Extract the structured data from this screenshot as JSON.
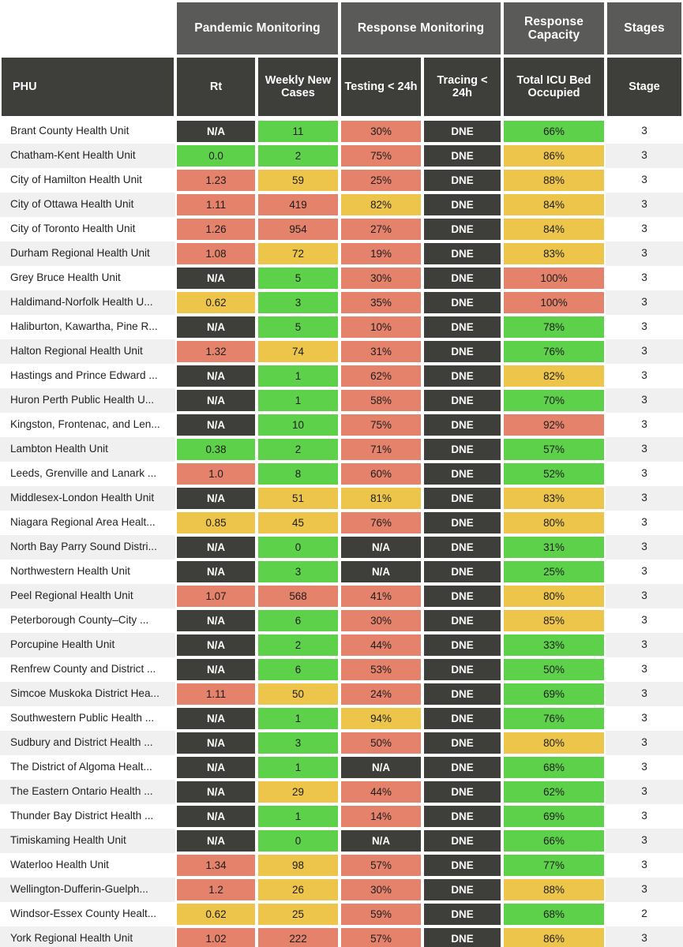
{
  "table": {
    "group_headers": [
      {
        "label": "",
        "span": 1,
        "visible": false
      },
      {
        "label": "Pandemic Monitoring",
        "span": 2,
        "visible": true
      },
      {
        "label": "Response Monitoring",
        "span": 2,
        "visible": true
      },
      {
        "label": "Response Capacity",
        "span": 1,
        "visible": true
      },
      {
        "label": "Stages",
        "span": 1,
        "visible": true
      }
    ],
    "columns": [
      {
        "key": "phu",
        "label": "PHU"
      },
      {
        "key": "rt",
        "label": "Rt"
      },
      {
        "key": "cases",
        "label": "Weekly New Cases"
      },
      {
        "key": "test",
        "label": "Testing < 24h"
      },
      {
        "key": "trace",
        "label": "Tracing < 24h"
      },
      {
        "key": "icu",
        "label": "Total ICU Bed Occupied"
      },
      {
        "key": "stage",
        "label": "Stage"
      }
    ],
    "colors": {
      "green": "#5ed14a",
      "yellow": "#edc54b",
      "red": "#e4826b",
      "dark": "#3e3e3b",
      "group_header": "#5a5a58",
      "sub_header": "#3e3e3b",
      "row_stripe": "#f0f0f0",
      "row_base": "#ffffff"
    },
    "rows": [
      {
        "phu": "Brant County Health Unit",
        "rt": "N/A",
        "rt_c": "dark",
        "cases": "11",
        "cases_c": "green",
        "test": "30%",
        "test_c": "red",
        "trace": "DNE",
        "trace_c": "dark",
        "icu": "66%",
        "icu_c": "green",
        "stage": "3"
      },
      {
        "phu": "Chatham-Kent Health Unit",
        "rt": "0.0",
        "rt_c": "green",
        "cases": "2",
        "cases_c": "green",
        "test": "75%",
        "test_c": "red",
        "trace": "DNE",
        "trace_c": "dark",
        "icu": "86%",
        "icu_c": "yellow",
        "stage": "3"
      },
      {
        "phu": "City of Hamilton Health Unit",
        "rt": "1.23",
        "rt_c": "red",
        "cases": "59",
        "cases_c": "yellow",
        "test": "25%",
        "test_c": "red",
        "trace": "DNE",
        "trace_c": "dark",
        "icu": "88%",
        "icu_c": "yellow",
        "stage": "3"
      },
      {
        "phu": "City of Ottawa Health Unit",
        "rt": "1.11",
        "rt_c": "red",
        "cases": "419",
        "cases_c": "red",
        "test": "82%",
        "test_c": "yellow",
        "trace": "DNE",
        "trace_c": "dark",
        "icu": "84%",
        "icu_c": "yellow",
        "stage": "3"
      },
      {
        "phu": "City of Toronto Health Unit",
        "rt": "1.26",
        "rt_c": "red",
        "cases": "954",
        "cases_c": "red",
        "test": "27%",
        "test_c": "red",
        "trace": "DNE",
        "trace_c": "dark",
        "icu": "84%",
        "icu_c": "yellow",
        "stage": "3"
      },
      {
        "phu": "Durham Regional Health Unit",
        "rt": "1.08",
        "rt_c": "red",
        "cases": "72",
        "cases_c": "yellow",
        "test": "19%",
        "test_c": "red",
        "trace": "DNE",
        "trace_c": "dark",
        "icu": "83%",
        "icu_c": "yellow",
        "stage": "3"
      },
      {
        "phu": "Grey Bruce Health Unit",
        "rt": "N/A",
        "rt_c": "dark",
        "cases": "5",
        "cases_c": "green",
        "test": "30%",
        "test_c": "red",
        "trace": "DNE",
        "trace_c": "dark",
        "icu": "100%",
        "icu_c": "red",
        "stage": "3"
      },
      {
        "phu": "Haldimand-Norfolk Health U...",
        "rt": "0.62",
        "rt_c": "yellow",
        "cases": "3",
        "cases_c": "green",
        "test": "35%",
        "test_c": "red",
        "trace": "DNE",
        "trace_c": "dark",
        "icu": "100%",
        "icu_c": "red",
        "stage": "3"
      },
      {
        "phu": "Haliburton, Kawartha, Pine R...",
        "rt": "N/A",
        "rt_c": "dark",
        "cases": "5",
        "cases_c": "green",
        "test": "10%",
        "test_c": "red",
        "trace": "DNE",
        "trace_c": "dark",
        "icu": "78%",
        "icu_c": "green",
        "stage": "3"
      },
      {
        "phu": "Halton Regional Health Unit",
        "rt": "1.32",
        "rt_c": "red",
        "cases": "74",
        "cases_c": "yellow",
        "test": "31%",
        "test_c": "red",
        "trace": "DNE",
        "trace_c": "dark",
        "icu": "76%",
        "icu_c": "green",
        "stage": "3"
      },
      {
        "phu": "Hastings and Prince Edward ...",
        "rt": "N/A",
        "rt_c": "dark",
        "cases": "1",
        "cases_c": "green",
        "test": "62%",
        "test_c": "red",
        "trace": "DNE",
        "trace_c": "dark",
        "icu": "82%",
        "icu_c": "yellow",
        "stage": "3"
      },
      {
        "phu": "Huron Perth Public Health U...",
        "rt": "N/A",
        "rt_c": "dark",
        "cases": "1",
        "cases_c": "green",
        "test": "58%",
        "test_c": "red",
        "trace": "DNE",
        "trace_c": "dark",
        "icu": "70%",
        "icu_c": "green",
        "stage": "3"
      },
      {
        "phu": "Kingston, Frontenac, and Len...",
        "rt": "N/A",
        "rt_c": "dark",
        "cases": "10",
        "cases_c": "green",
        "test": "75%",
        "test_c": "red",
        "trace": "DNE",
        "trace_c": "dark",
        "icu": "92%",
        "icu_c": "red",
        "stage": "3"
      },
      {
        "phu": "Lambton Health Unit",
        "rt": "0.38",
        "rt_c": "green",
        "cases": "2",
        "cases_c": "green",
        "test": "71%",
        "test_c": "red",
        "trace": "DNE",
        "trace_c": "dark",
        "icu": "57%",
        "icu_c": "green",
        "stage": "3"
      },
      {
        "phu": "Leeds, Grenville and Lanark ...",
        "rt": "1.0",
        "rt_c": "red",
        "cases": "8",
        "cases_c": "green",
        "test": "60%",
        "test_c": "red",
        "trace": "DNE",
        "trace_c": "dark",
        "icu": "52%",
        "icu_c": "green",
        "stage": "3"
      },
      {
        "phu": "Middlesex-London Health Unit",
        "rt": "N/A",
        "rt_c": "dark",
        "cases": "51",
        "cases_c": "yellow",
        "test": "81%",
        "test_c": "yellow",
        "trace": "DNE",
        "trace_c": "dark",
        "icu": "83%",
        "icu_c": "yellow",
        "stage": "3"
      },
      {
        "phu": "Niagara Regional Area Healt...",
        "rt": "0.85",
        "rt_c": "yellow",
        "cases": "45",
        "cases_c": "yellow",
        "test": "76%",
        "test_c": "red",
        "trace": "DNE",
        "trace_c": "dark",
        "icu": "80%",
        "icu_c": "yellow",
        "stage": "3"
      },
      {
        "phu": "North Bay Parry Sound Distri...",
        "rt": "N/A",
        "rt_c": "dark",
        "cases": "0",
        "cases_c": "green",
        "test": "N/A",
        "test_c": "dark",
        "trace": "DNE",
        "trace_c": "dark",
        "icu": "31%",
        "icu_c": "green",
        "stage": "3"
      },
      {
        "phu": "Northwestern Health Unit",
        "rt": "N/A",
        "rt_c": "dark",
        "cases": "3",
        "cases_c": "green",
        "test": "N/A",
        "test_c": "dark",
        "trace": "DNE",
        "trace_c": "dark",
        "icu": "25%",
        "icu_c": "green",
        "stage": "3"
      },
      {
        "phu": "Peel Regional Health Unit",
        "rt": "1.07",
        "rt_c": "red",
        "cases": "568",
        "cases_c": "red",
        "test": "41%",
        "test_c": "red",
        "trace": "DNE",
        "trace_c": "dark",
        "icu": "80%",
        "icu_c": "yellow",
        "stage": "3"
      },
      {
        "phu": "Peterborough County–City ...",
        "rt": "N/A",
        "rt_c": "dark",
        "cases": "6",
        "cases_c": "green",
        "test": "30%",
        "test_c": "red",
        "trace": "DNE",
        "trace_c": "dark",
        "icu": "85%",
        "icu_c": "yellow",
        "stage": "3"
      },
      {
        "phu": "Porcupine Health Unit",
        "rt": "N/A",
        "rt_c": "dark",
        "cases": "2",
        "cases_c": "green",
        "test": "44%",
        "test_c": "red",
        "trace": "DNE",
        "trace_c": "dark",
        "icu": "33%",
        "icu_c": "green",
        "stage": "3"
      },
      {
        "phu": "Renfrew County and District ...",
        "rt": "N/A",
        "rt_c": "dark",
        "cases": "6",
        "cases_c": "green",
        "test": "53%",
        "test_c": "red",
        "trace": "DNE",
        "trace_c": "dark",
        "icu": "50%",
        "icu_c": "green",
        "stage": "3"
      },
      {
        "phu": "Simcoe Muskoka District Hea...",
        "rt": "1.11",
        "rt_c": "red",
        "cases": "50",
        "cases_c": "yellow",
        "test": "24%",
        "test_c": "red",
        "trace": "DNE",
        "trace_c": "dark",
        "icu": "69%",
        "icu_c": "green",
        "stage": "3"
      },
      {
        "phu": "Southwestern Public Health ...",
        "rt": "N/A",
        "rt_c": "dark",
        "cases": "1",
        "cases_c": "green",
        "test": "94%",
        "test_c": "yellow",
        "trace": "DNE",
        "trace_c": "dark",
        "icu": "76%",
        "icu_c": "green",
        "stage": "3"
      },
      {
        "phu": "Sudbury and District Health ...",
        "rt": "N/A",
        "rt_c": "dark",
        "cases": "3",
        "cases_c": "green",
        "test": "50%",
        "test_c": "red",
        "trace": "DNE",
        "trace_c": "dark",
        "icu": "80%",
        "icu_c": "yellow",
        "stage": "3"
      },
      {
        "phu": "The District of Algoma Healt...",
        "rt": "N/A",
        "rt_c": "dark",
        "cases": "1",
        "cases_c": "green",
        "test": "N/A",
        "test_c": "dark",
        "trace": "DNE",
        "trace_c": "dark",
        "icu": "68%",
        "icu_c": "green",
        "stage": "3"
      },
      {
        "phu": "The Eastern Ontario Health ...",
        "rt": "N/A",
        "rt_c": "dark",
        "cases": "29",
        "cases_c": "yellow",
        "test": "44%",
        "test_c": "red",
        "trace": "DNE",
        "trace_c": "dark",
        "icu": "62%",
        "icu_c": "green",
        "stage": "3"
      },
      {
        "phu": "Thunder Bay District Health ...",
        "rt": "N/A",
        "rt_c": "dark",
        "cases": "1",
        "cases_c": "green",
        "test": "14%",
        "test_c": "red",
        "trace": "DNE",
        "trace_c": "dark",
        "icu": "69%",
        "icu_c": "green",
        "stage": "3"
      },
      {
        "phu": "Timiskaming Health Unit",
        "rt": "N/A",
        "rt_c": "dark",
        "cases": "0",
        "cases_c": "green",
        "test": "N/A",
        "test_c": "dark",
        "trace": "DNE",
        "trace_c": "dark",
        "icu": "66%",
        "icu_c": "green",
        "stage": "3"
      },
      {
        "phu": "Waterloo Health Unit",
        "rt": "1.34",
        "rt_c": "red",
        "cases": "98",
        "cases_c": "yellow",
        "test": "57%",
        "test_c": "red",
        "trace": "DNE",
        "trace_c": "dark",
        "icu": "77%",
        "icu_c": "green",
        "stage": "3"
      },
      {
        "phu": "Wellington-Dufferin-Guelph...",
        "rt": "1.2",
        "rt_c": "red",
        "cases": "26",
        "cases_c": "yellow",
        "test": "30%",
        "test_c": "red",
        "trace": "DNE",
        "trace_c": "dark",
        "icu": "88%",
        "icu_c": "yellow",
        "stage": "3"
      },
      {
        "phu": "Windsor-Essex County Healt...",
        "rt": "0.62",
        "rt_c": "yellow",
        "cases": "25",
        "cases_c": "yellow",
        "test": "59%",
        "test_c": "red",
        "trace": "DNE",
        "trace_c": "dark",
        "icu": "68%",
        "icu_c": "green",
        "stage": "2"
      },
      {
        "phu": "York Regional Health Unit",
        "rt": "1.02",
        "rt_c": "red",
        "cases": "222",
        "cases_c": "red",
        "test": "57%",
        "test_c": "red",
        "trace": "DNE",
        "trace_c": "dark",
        "icu": "86%",
        "icu_c": "yellow",
        "stage": "3"
      }
    ]
  }
}
